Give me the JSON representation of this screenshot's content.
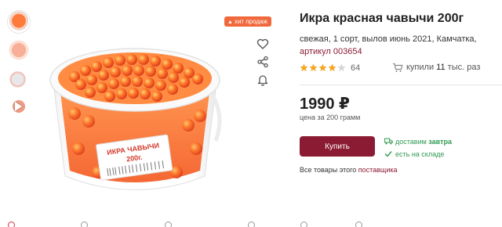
{
  "thumbnails": [
    {
      "icon": "caviar-jar-thumbnail",
      "active": true
    },
    {
      "icon": "caviar-plate-thumbnail",
      "active": false
    },
    {
      "icon": "caviar-closeup-thumbnail",
      "active": false
    },
    {
      "icon": "video-play-thumbnail",
      "active": false
    }
  ],
  "badge": {
    "text": "хит продаж",
    "icon": "fire-icon",
    "color": "#f0683b"
  },
  "product_image": {
    "label_line1": "ИКРА ЧАВЫЧИ",
    "label_line2": "200г."
  },
  "side_actions": [
    "heart-icon",
    "share-icon",
    "bell-icon"
  ],
  "product": {
    "title": "Икра красная чавычи 200г",
    "description": "свежая, 1 сорт, вылов июнь 2021, Камчатка,",
    "sku_label": "артикул",
    "sku": "003654",
    "rating": 4,
    "rating_max": 5,
    "reviews_count": "64",
    "bought_prefix": "купили",
    "bought_count": "11",
    "bought_suffix": "тыс. раз"
  },
  "price": {
    "value": "1990 ₽",
    "note": "цена за 200 грамм"
  },
  "buy_button": {
    "label": "Купить"
  },
  "delivery": {
    "line1_prefix": "доставим",
    "line1_bold": "завтра",
    "line2": "есть на складе"
  },
  "all_goods": {
    "prefix": "Все товары этого",
    "link": "поставщика"
  },
  "colors": {
    "accent": "#8b1b33",
    "green": "#2e9a52",
    "star": "#f5a623",
    "badge": "#f0683b"
  }
}
